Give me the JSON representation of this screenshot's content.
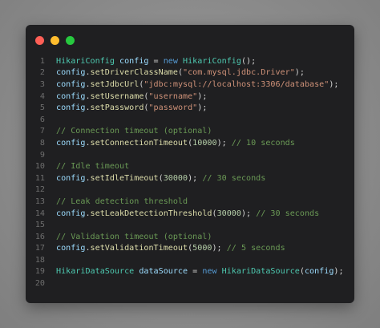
{
  "window": {
    "buttons": [
      {
        "name": "close",
        "color": "#ff5f56"
      },
      {
        "name": "minimize",
        "color": "#ffbd2e"
      },
      {
        "name": "maximize",
        "color": "#27c93f"
      }
    ]
  },
  "code": {
    "lines": [
      {
        "n": "1",
        "tokens": [
          {
            "t": "HikariConfig",
            "c": "ty"
          },
          {
            "t": " ",
            "c": "src"
          },
          {
            "t": "config",
            "c": "var"
          },
          {
            "t": " = ",
            "c": "src"
          },
          {
            "t": "new",
            "c": "kw"
          },
          {
            "t": " ",
            "c": "src"
          },
          {
            "t": "HikariConfig",
            "c": "ty"
          },
          {
            "t": "();",
            "c": "src"
          }
        ]
      },
      {
        "n": "2",
        "tokens": [
          {
            "t": "config",
            "c": "var"
          },
          {
            "t": ".",
            "c": "src"
          },
          {
            "t": "setDriverClassName",
            "c": "fn"
          },
          {
            "t": "(",
            "c": "src"
          },
          {
            "t": "\"com.mysql.jdbc.Driver\"",
            "c": "str"
          },
          {
            "t": ");",
            "c": "src"
          }
        ]
      },
      {
        "n": "3",
        "tokens": [
          {
            "t": "config",
            "c": "var"
          },
          {
            "t": ".",
            "c": "src"
          },
          {
            "t": "setJdbcUrl",
            "c": "fn"
          },
          {
            "t": "(",
            "c": "src"
          },
          {
            "t": "\"jdbc:mysql://localhost:3306/database\"",
            "c": "str"
          },
          {
            "t": ");",
            "c": "src"
          }
        ]
      },
      {
        "n": "4",
        "tokens": [
          {
            "t": "config",
            "c": "var"
          },
          {
            "t": ".",
            "c": "src"
          },
          {
            "t": "setUsername",
            "c": "fn"
          },
          {
            "t": "(",
            "c": "src"
          },
          {
            "t": "\"username\"",
            "c": "str"
          },
          {
            "t": ");",
            "c": "src"
          }
        ]
      },
      {
        "n": "5",
        "tokens": [
          {
            "t": "config",
            "c": "var"
          },
          {
            "t": ".",
            "c": "src"
          },
          {
            "t": "setPassword",
            "c": "fn"
          },
          {
            "t": "(",
            "c": "src"
          },
          {
            "t": "\"password\"",
            "c": "str"
          },
          {
            "t": ");",
            "c": "src"
          }
        ]
      },
      {
        "n": "6",
        "tokens": []
      },
      {
        "n": "7",
        "tokens": [
          {
            "t": "// Connection timeout (optional)",
            "c": "cm"
          }
        ]
      },
      {
        "n": "8",
        "tokens": [
          {
            "t": "config",
            "c": "var"
          },
          {
            "t": ".",
            "c": "src"
          },
          {
            "t": "setConnectionTimeout",
            "c": "fn"
          },
          {
            "t": "(",
            "c": "src"
          },
          {
            "t": "10000",
            "c": "num"
          },
          {
            "t": "); ",
            "c": "src"
          },
          {
            "t": "// 10 seconds",
            "c": "cm"
          }
        ]
      },
      {
        "n": "9",
        "tokens": []
      },
      {
        "n": "10",
        "tokens": [
          {
            "t": "// Idle timeout",
            "c": "cm"
          }
        ]
      },
      {
        "n": "11",
        "tokens": [
          {
            "t": "config",
            "c": "var"
          },
          {
            "t": ".",
            "c": "src"
          },
          {
            "t": "setIdleTimeout",
            "c": "fn"
          },
          {
            "t": "(",
            "c": "src"
          },
          {
            "t": "30000",
            "c": "num"
          },
          {
            "t": "); ",
            "c": "src"
          },
          {
            "t": "// 30 seconds",
            "c": "cm"
          }
        ]
      },
      {
        "n": "12",
        "tokens": []
      },
      {
        "n": "13",
        "tokens": [
          {
            "t": "// Leak detection threshold",
            "c": "cm"
          }
        ]
      },
      {
        "n": "14",
        "tokens": [
          {
            "t": "config",
            "c": "var"
          },
          {
            "t": ".",
            "c": "src"
          },
          {
            "t": "setLeakDetectionThreshold",
            "c": "fn"
          },
          {
            "t": "(",
            "c": "src"
          },
          {
            "t": "30000",
            "c": "num"
          },
          {
            "t": "); ",
            "c": "src"
          },
          {
            "t": "// 30 seconds",
            "c": "cm"
          }
        ]
      },
      {
        "n": "15",
        "tokens": []
      },
      {
        "n": "16",
        "tokens": [
          {
            "t": "// Validation timeout (optional)",
            "c": "cm"
          }
        ]
      },
      {
        "n": "17",
        "tokens": [
          {
            "t": "config",
            "c": "var"
          },
          {
            "t": ".",
            "c": "src"
          },
          {
            "t": "setValidationTimeout",
            "c": "fn"
          },
          {
            "t": "(",
            "c": "src"
          },
          {
            "t": "5000",
            "c": "num"
          },
          {
            "t": "); ",
            "c": "src"
          },
          {
            "t": "// 5 seconds",
            "c": "cm"
          }
        ]
      },
      {
        "n": "18",
        "tokens": []
      },
      {
        "n": "19",
        "tokens": [
          {
            "t": "HikariDataSource",
            "c": "ty"
          },
          {
            "t": " ",
            "c": "src"
          },
          {
            "t": "dataSource",
            "c": "var"
          },
          {
            "t": " = ",
            "c": "src"
          },
          {
            "t": "new",
            "c": "kw"
          },
          {
            "t": " ",
            "c": "src"
          },
          {
            "t": "HikariDataSource",
            "c": "ty"
          },
          {
            "t": "(",
            "c": "src"
          },
          {
            "t": "config",
            "c": "var"
          },
          {
            "t": ");",
            "c": "src"
          }
        ]
      },
      {
        "n": "20",
        "tokens": []
      }
    ]
  }
}
